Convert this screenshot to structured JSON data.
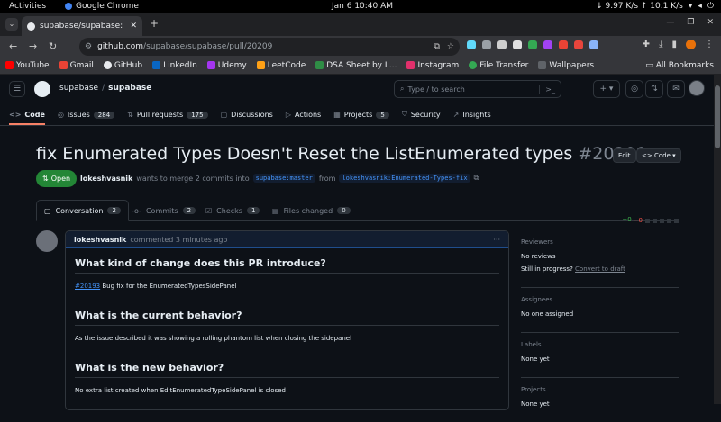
{
  "os": {
    "activities": "Activities",
    "app": "Google Chrome",
    "clock": "Jan 6  10:40 AM",
    "net": "↓ 9.97 K/s ↑ 10.1 K/s"
  },
  "browser": {
    "tab_title": "supabase/supabase: Th",
    "url_domain": "github.com",
    "url_path": "/supabase/supabase/pull/20209",
    "bookmarks": [
      "YouTube",
      "Gmail",
      "GitHub",
      "LinkedIn",
      "Udemy",
      "LeetCode",
      "DSA Sheet by L...",
      "Instagram",
      "File Transfer",
      "Wallpapers"
    ],
    "all_bookmarks": "All Bookmarks"
  },
  "github": {
    "owner": "supabase",
    "repo": "supabase",
    "search_placeholder": "Type / to search",
    "repo_tabs": [
      {
        "label": "Code",
        "count": ""
      },
      {
        "label": "Issues",
        "count": "284"
      },
      {
        "label": "Pull requests",
        "count": "175"
      },
      {
        "label": "Discussions",
        "count": ""
      },
      {
        "label": "Actions",
        "count": ""
      },
      {
        "label": "Projects",
        "count": "5"
      },
      {
        "label": "Security",
        "count": ""
      },
      {
        "label": "Insights",
        "count": ""
      }
    ]
  },
  "pr": {
    "title": "fix Enumerated Types Doesn't Reset the ListEnumerated types",
    "number": "#20209",
    "edit": "Edit",
    "code": "Code",
    "status": "Open",
    "author": "lokeshvasnik",
    "meta_text": "wants to merge 2 commits into",
    "base": "supabase:master",
    "from": "from",
    "head": "lokeshvasnik:Enumerated-Types-fix",
    "tabs": [
      {
        "label": "Conversation",
        "count": "2"
      },
      {
        "label": "Commits",
        "count": "2"
      },
      {
        "label": "Checks",
        "count": "1"
      },
      {
        "label": "Files changed",
        "count": "0"
      }
    ],
    "diff_add": "+0",
    "diff_del": "−0"
  },
  "comment": {
    "author": "lokeshvasnik",
    "when": "commented 3 minutes ago",
    "h1": "What kind of change does this PR introduce?",
    "issue_link": "#20193",
    "p1": " Bug fix for the EnumeratedTypesSidePanel",
    "h2": "What is the current behavior?",
    "p2": "As the issue described it was showing a rolling phantom list when closing the sidepanel",
    "h3": "What is the new behavior?",
    "p3": "No extra list created when EditEnumeratedTypeSidePanel is closed"
  },
  "sidebar": {
    "reviewers": "Reviewers",
    "no_reviews": "No reviews",
    "still": "Still in progress?",
    "convert": "Convert to draft",
    "assignees": "Assignees",
    "no_one": "No one assigned",
    "labels": "Labels",
    "none_yet": "None yet",
    "projects": "Projects",
    "projects_none": "None yet"
  }
}
